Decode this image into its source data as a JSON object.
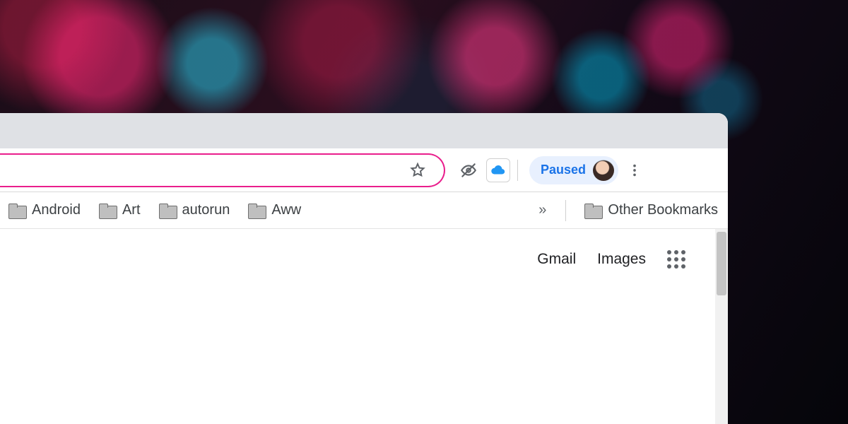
{
  "profile": {
    "status_label": "Paused"
  },
  "bookmarks": {
    "items": [
      {
        "label": "Android"
      },
      {
        "label": "Art"
      },
      {
        "label": "autorun"
      },
      {
        "label": "Aww"
      }
    ],
    "other_label": "Other Bookmarks"
  },
  "content": {
    "links": [
      {
        "label": "Gmail"
      },
      {
        "label": "Images"
      }
    ]
  },
  "colors": {
    "omnibox_ring": "#e91e8c",
    "profile_chip_bg": "#e8f0fe",
    "profile_chip_text": "#1a73e8"
  }
}
